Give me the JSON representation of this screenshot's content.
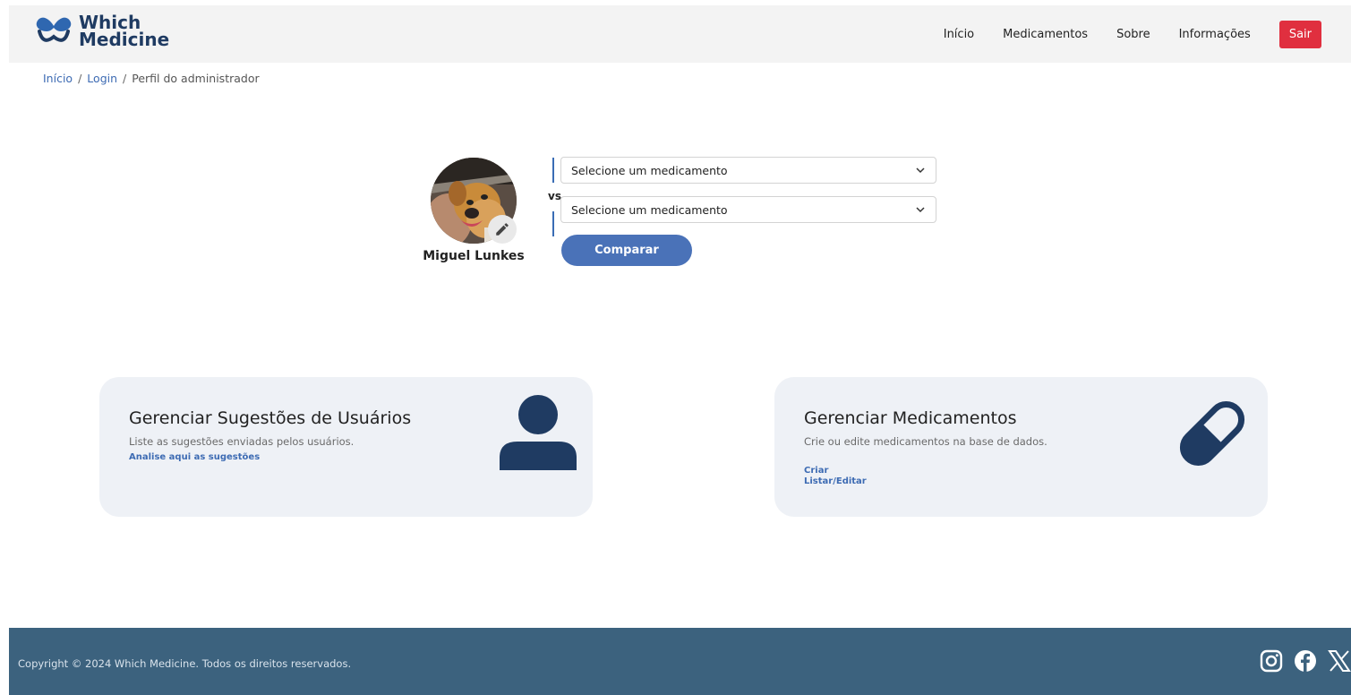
{
  "header": {
    "logo_line1": "Which",
    "logo_line2": "Medicine",
    "nav": [
      "Início",
      "Medicamentos",
      "Sobre",
      "Informações"
    ],
    "logout_label": "Sair"
  },
  "breadcrumb": {
    "items": [
      "Início",
      "Login"
    ],
    "current": "Perfil do administrador",
    "separator": "/"
  },
  "profile": {
    "name": "Miguel Lunkes"
  },
  "comparator": {
    "select1_value": "Selecione um medicamento",
    "vs_label": "vs",
    "select2_value": "Selecione um medicamento",
    "compare_label": "Comparar"
  },
  "cards": [
    {
      "title": "Gerenciar Sugestões de Usuários",
      "description": "Liste as sugestões enviadas pelos usuários.",
      "links": [
        "Analise aqui as sugestões"
      ],
      "icon": "user-icon"
    },
    {
      "title": "Gerenciar Medicamentos",
      "description": "Crie ou edite medicamentos na base de dados.",
      "links": [
        "Criar",
        "Listar/Editar"
      ],
      "icon": "pill-icon"
    }
  ],
  "footer": {
    "copyright": "Copyright © 2024 Which Medicine. Todos os direitos reservados.",
    "social": [
      "instagram-icon",
      "facebook-icon",
      "x-icon"
    ]
  },
  "colors": {
    "brand": "#1f3b62",
    "accent": "#4a72b8",
    "danger": "#e02f3f",
    "footer": "#3c627e",
    "card_bg": "#eef1f6"
  }
}
